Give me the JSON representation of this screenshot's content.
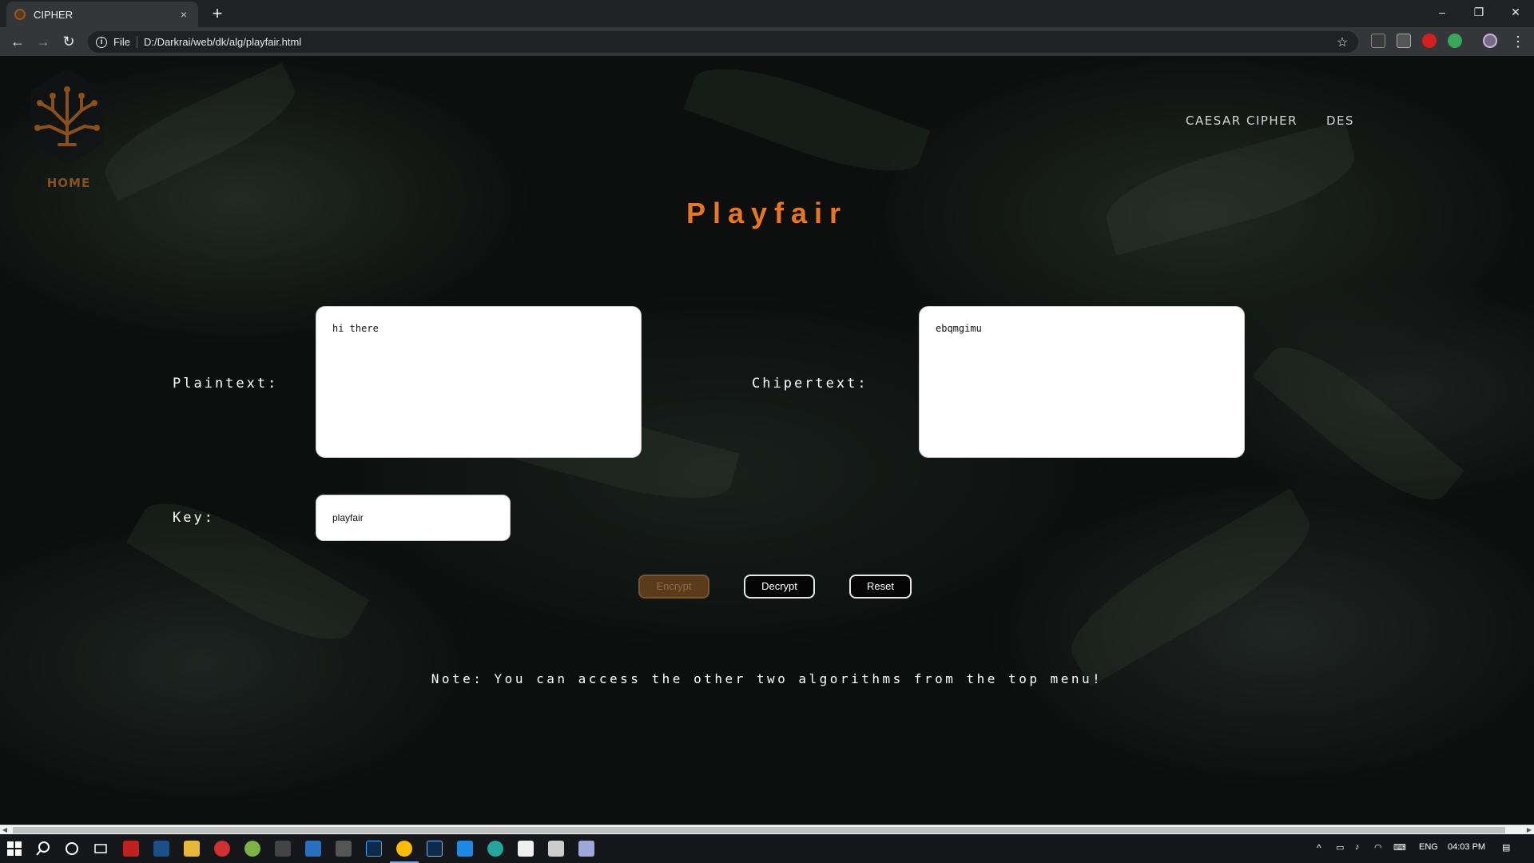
{
  "browser": {
    "tab_title": "CIPHER",
    "tab_close": "×",
    "new_tab": "+",
    "scheme": "File",
    "url": "D:/Darkrai/web/dk/alg/playfair.html",
    "info_icon": "i",
    "star_icon": "☆",
    "back_icon": "←",
    "forward_icon": "→",
    "reload_icon": "↻",
    "minimize": "–",
    "restore": "❐",
    "close": "✕",
    "menu_icon": "⋮"
  },
  "nav": {
    "home_label": "HOME",
    "links": [
      "CAESAR CIPHER",
      "DES"
    ]
  },
  "page": {
    "title": "Playfair",
    "plaintext_label": "Plaintext:",
    "plaintext_value": "hi there",
    "ciphertext_label": "Chipertext:",
    "ciphertext_value": "ebqmgimu",
    "key_label": "Key:",
    "key_value": "playfair",
    "encrypt_label": "Encrypt",
    "decrypt_label": "Decrypt",
    "reset_label": "Reset",
    "note": "Note: You can access the other two algorithms from the top menu!"
  },
  "taskbar": {
    "language": "ENG",
    "time": "04:03 PM"
  },
  "colors": {
    "accent": "#e87722",
    "logo": "#8a4f1c"
  }
}
